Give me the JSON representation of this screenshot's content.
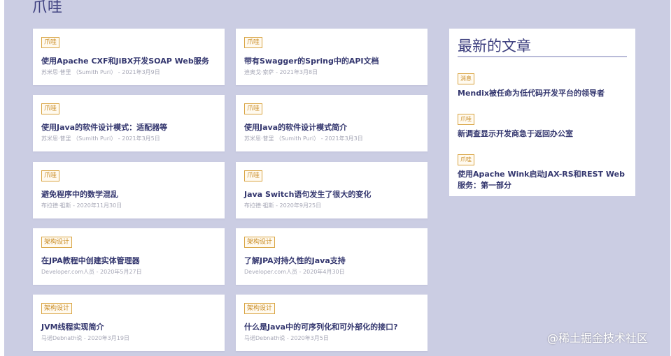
{
  "section_title": "爪哇",
  "cards": [
    {
      "tag": "爪哇",
      "title": "使用Apache CXF和JiBX开发SOAP Web服务",
      "meta": "苏米思·普里 （Sumith Puri） - 2021年3月9日"
    },
    {
      "tag": "爪哇",
      "title": "带有Swagger的Spring中的API文档",
      "meta": "迪奥戈·索萨 - 2021年3月8日"
    },
    {
      "tag": "爪哇",
      "title": "使用Java的软件设计模式：适配器等",
      "meta": "苏米思·普里 （Sumith Puri） - 2021年3月5日"
    },
    {
      "tag": "爪哇",
      "title": "使用Java的软件设计模式简介",
      "meta": "苏米思·普里 （Sumith Puri） - 2021年3月3日"
    },
    {
      "tag": "爪哇",
      "title": "避免程序中的数学混乱",
      "meta": "布拉德·祖斯 - 2020年11月30日"
    },
    {
      "tag": "爪哇",
      "title": "Java Switch语句发生了很大的变化",
      "meta": "布拉德·祖斯 - 2020年9月25日"
    },
    {
      "tag": "架构设计",
      "title": "在JPA教程中创建实体管理器",
      "meta": "Developer.com人员 - 2020年5月27日"
    },
    {
      "tag": "架构设计",
      "title": "了解JPA对持久性的Java支持",
      "meta": "Developer.com人员 - 2020年4月30日"
    },
    {
      "tag": "架构设计",
      "title": "JVM线程实现简介",
      "meta": "马诺Debnath说 - 2020年3月19日"
    },
    {
      "tag": "架构设计",
      "title": "什么是Java中的可序列化和可外部化的接口?",
      "meta": "马诺Debnath说 - 2020年3月5日"
    }
  ],
  "sidebar": {
    "title": "最新的文章",
    "items": [
      {
        "tag": "消息",
        "title": "Mendix被任命为低代码开发平台的领导者"
      },
      {
        "tag": "爪哇",
        "title": "新调查显示开发商急于返回办公室"
      },
      {
        "tag": "爪哇",
        "title": "使用Apache Wink启动JAX-RS和REST Web服务：第一部分"
      }
    ]
  },
  "watermark": "@稀土掘金技术社区",
  "colors": {
    "background": "#cbcde3",
    "tag_border": "#d9a442",
    "title": "#34376f"
  }
}
